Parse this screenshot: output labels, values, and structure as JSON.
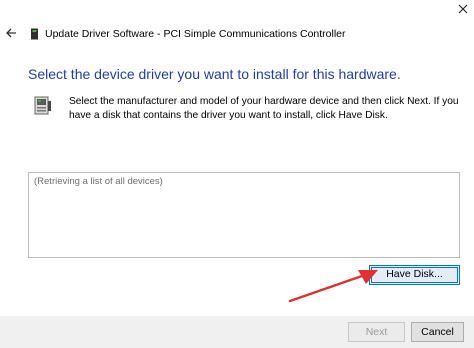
{
  "window": {
    "title": "Update Driver Software - PCI Simple Communications Controller"
  },
  "content": {
    "heading": "Select the device driver you want to install for this hardware.",
    "instruction": "Select the manufacturer and model of your hardware device and then click Next. If you have a disk that contains the driver you want to install, click Have Disk.",
    "list_placeholder": "(Retrieving a list of all devices)",
    "have_disk_label": "Have Disk..."
  },
  "footer": {
    "next_label": "Next",
    "cancel_label": "Cancel"
  },
  "icons": {
    "back": "back-arrow-icon",
    "close": "close-icon",
    "driver": "driver-chip-icon",
    "hardware": "hardware-device-icon"
  },
  "colors": {
    "heading": "#1f3fa8",
    "focus_border": "#0078d7",
    "annotation_arrow": "#e03030",
    "footer_bg": "#f0f0f0"
  }
}
